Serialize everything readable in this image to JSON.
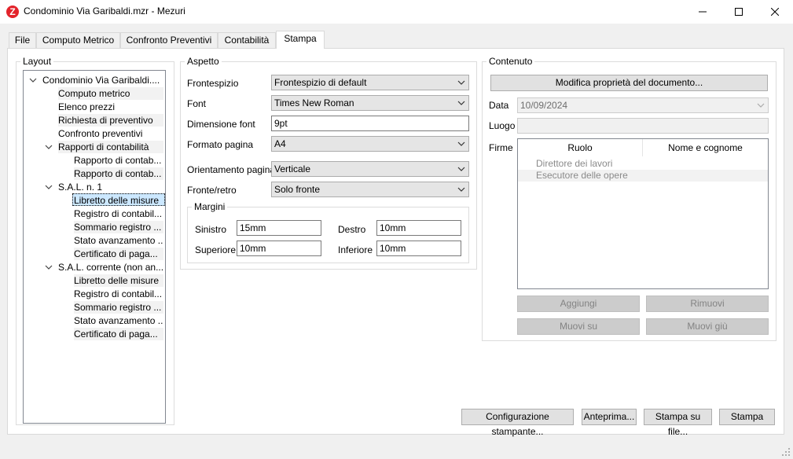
{
  "window": {
    "title": "Condominio Via Garibaldi.mzr - Mezuri",
    "logo_letter": "Z"
  },
  "tabs": [
    {
      "label": "File"
    },
    {
      "label": "Computo Metrico"
    },
    {
      "label": "Confronto Preventivi"
    },
    {
      "label": "Contabilità"
    },
    {
      "label": "Stampa"
    }
  ],
  "layout": {
    "legend": "Layout",
    "tree": [
      {
        "label": "Condominio Via Garibaldi...."
      },
      {
        "label": "Computo metrico"
      },
      {
        "label": "Elenco prezzi"
      },
      {
        "label": "Richiesta di preventivo"
      },
      {
        "label": "Confronto preventivi"
      },
      {
        "label": "Rapporti di contabilità"
      },
      {
        "label": "Rapporto di contab..."
      },
      {
        "label": "Rapporto di contab..."
      },
      {
        "label": "S.A.L. n. 1"
      },
      {
        "label": "Libretto delle misure"
      },
      {
        "label": "Registro di contabil..."
      },
      {
        "label": "Sommario registro ..."
      },
      {
        "label": "Stato avanzamento ..."
      },
      {
        "label": "Certificato di paga..."
      },
      {
        "label": "S.A.L. corrente (non an..."
      },
      {
        "label": "Libretto delle misure"
      },
      {
        "label": "Registro di contabil..."
      },
      {
        "label": "Sommario registro ..."
      },
      {
        "label": "Stato avanzamento ..."
      },
      {
        "label": "Certificato di paga..."
      }
    ]
  },
  "aspetto": {
    "legend": "Aspetto",
    "frontespizio_label": "Frontespizio",
    "frontespizio_value": "Frontespizio di default",
    "font_label": "Font",
    "font_value": "Times New Roman",
    "dimensione_label": "Dimensione font",
    "dimensione_value": "9pt",
    "formato_label": "Formato pagina",
    "formato_value": "A4",
    "orientamento_label": "Orientamento pagina",
    "orientamento_value": "Verticale",
    "fronte_label": "Fronte/retro",
    "fronte_value": "Solo fronte",
    "margini": {
      "legend": "Margini",
      "sinistro_label": "Sinistro",
      "sinistro_value": "15mm",
      "destro_label": "Destro",
      "destro_value": "10mm",
      "superiore_label": "Superiore",
      "superiore_value": "10mm",
      "inferiore_label": "Inferiore",
      "inferiore_value": "10mm"
    }
  },
  "contenuto": {
    "legend": "Contenuto",
    "modifica_button": "Modifica proprietà del documento...",
    "data_label": "Data",
    "data_value": "10/09/2024",
    "luogo_label": "Luogo",
    "luogo_value": "",
    "firme_label": "Firme",
    "columns": [
      "Ruolo",
      "Nome e cognome"
    ],
    "rows": [
      {
        "ruolo": "Direttore dei lavori"
      },
      {
        "ruolo": "Esecutore delle opere"
      }
    ],
    "aggiungi": "Aggiungi",
    "rimuovi": "Rimuovi",
    "muovi_su": "Muovi su",
    "muovi_giu": "Muovi giù"
  },
  "footer": {
    "configurazione": "Configurazione stampante...",
    "anteprima": "Anteprima...",
    "stampa_file": "Stampa su file...",
    "stampa": "Stampa"
  }
}
